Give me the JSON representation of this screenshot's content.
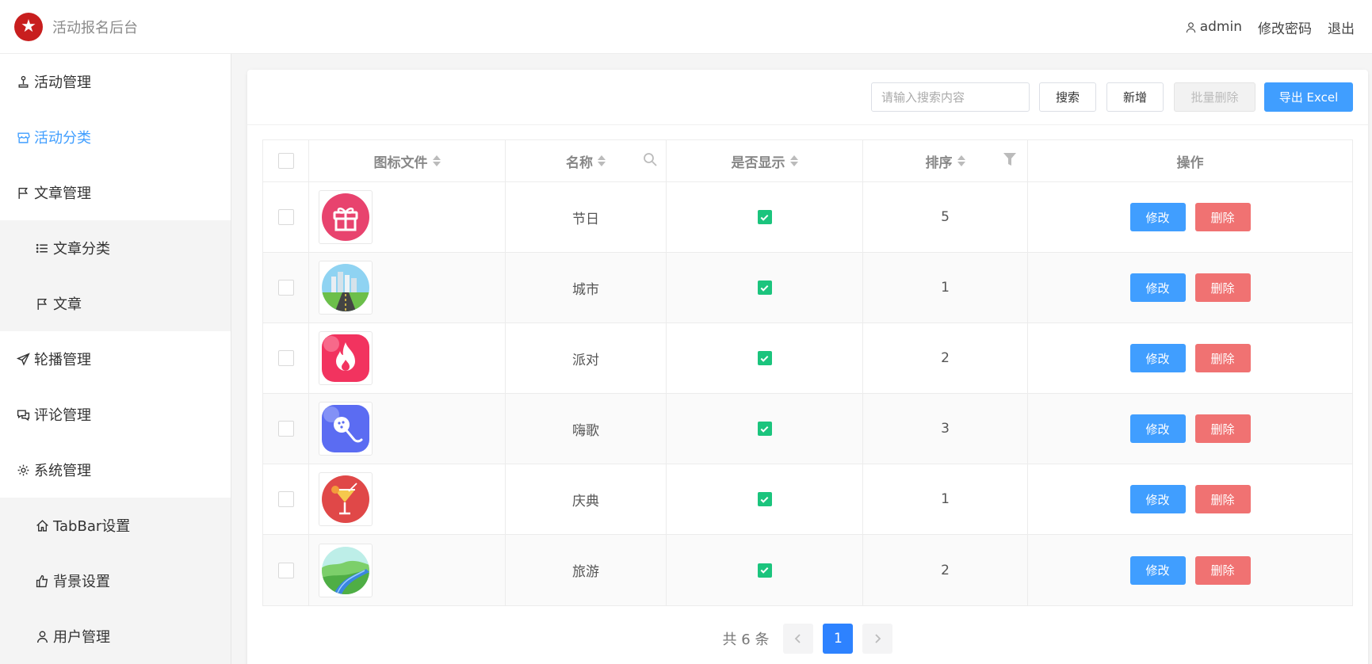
{
  "header": {
    "app_title": "活动报名后台",
    "username": "admin",
    "change_password": "修改密码",
    "logout": "退出"
  },
  "sidebar": {
    "items": [
      {
        "label": "活动管理",
        "icon": "joystick-icon",
        "active": false,
        "sub": false
      },
      {
        "label": "活动分类",
        "icon": "store-icon",
        "active": true,
        "sub": false
      },
      {
        "label": "文章管理",
        "icon": "flag-icon",
        "active": false,
        "sub": false
      },
      {
        "label": "文章分类",
        "icon": "list-icon",
        "active": false,
        "sub": true
      },
      {
        "label": "文章",
        "icon": "flag-icon",
        "active": false,
        "sub": true
      },
      {
        "label": "轮播管理",
        "icon": "send-icon",
        "active": false,
        "sub": false
      },
      {
        "label": "评论管理",
        "icon": "chat-icon",
        "active": false,
        "sub": false
      },
      {
        "label": "系统管理",
        "icon": "gear-icon",
        "active": false,
        "sub": false
      },
      {
        "label": "TabBar设置",
        "icon": "home-icon",
        "active": false,
        "sub": true
      },
      {
        "label": "背景设置",
        "icon": "thumb-up-icon",
        "active": false,
        "sub": true
      },
      {
        "label": "用户管理",
        "icon": "user-icon",
        "active": false,
        "sub": true
      }
    ]
  },
  "toolbar": {
    "search_placeholder": "请输入搜索内容",
    "search_label": "搜索",
    "add_label": "新增",
    "batch_delete_label": "批量删除",
    "export_label": "导出 Excel"
  },
  "table": {
    "columns": [
      "图标文件",
      "名称",
      "是否显示",
      "排序",
      "操作"
    ],
    "rows": [
      {
        "icon": "gift-icon",
        "name": "节日",
        "show": true,
        "order": "5"
      },
      {
        "icon": "city-icon",
        "name": "城市",
        "show": true,
        "order": "1"
      },
      {
        "icon": "fire-icon",
        "name": "派对",
        "show": true,
        "order": "2"
      },
      {
        "icon": "microphone-icon",
        "name": "嗨歌",
        "show": true,
        "order": "3"
      },
      {
        "icon": "cocktail-icon",
        "name": "庆典",
        "show": true,
        "order": "1"
      },
      {
        "icon": "landscape-icon",
        "name": "旅游",
        "show": true,
        "order": "2"
      }
    ],
    "edit_label": "修改",
    "delete_label": "删除"
  },
  "pagination": {
    "total_text": "共 6 条",
    "current_page": "1"
  },
  "colors": {
    "primary": "#409eff",
    "danger": "#f07272",
    "success": "#1bc47d",
    "page_active": "#2d82ff"
  }
}
